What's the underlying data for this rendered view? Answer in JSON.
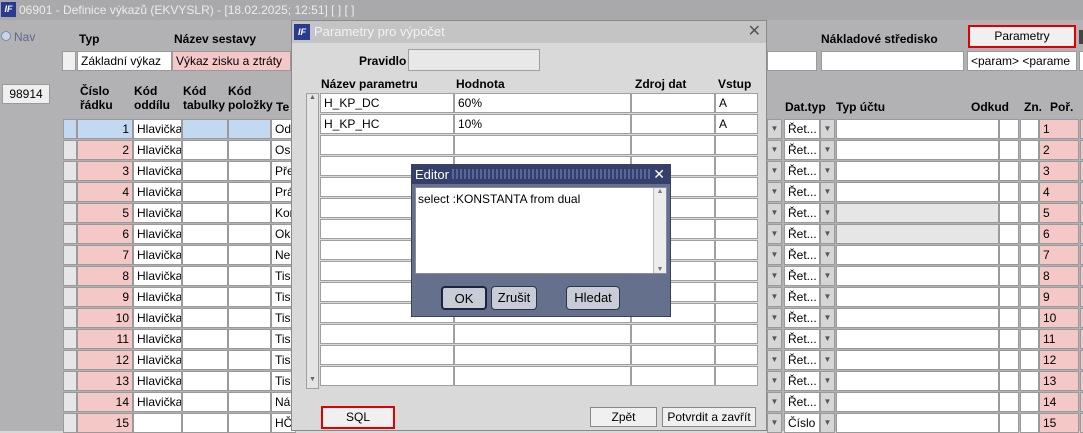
{
  "window": {
    "title": "06901 - Definice výkazů (EKVYSLR) - [18.02.2025; 12:51]  [ ]  [ ]",
    "logo": "IF"
  },
  "nav": {
    "label": "Nav",
    "code": "98914"
  },
  "header": {
    "typ_label": "Typ",
    "nazev_label": "Název sestavy",
    "typ_value": "Základní výkaz",
    "nazev_value": "Výkaz zisku a ztráty",
    "naklad_label": "Nákladové středisko",
    "parametry_button": "Parametry",
    "param_value": "<param>  <parame"
  },
  "grid": {
    "col_cislo": "Číslo řádku",
    "col_cislo_1": "Číslo",
    "col_cislo_2": "řádku",
    "col_oddil_1": "Kód",
    "col_oddil_2": "oddílu",
    "col_tabulka_1": "Kód",
    "col_tabulka_2": "tabulky",
    "col_polozka_1": "Kód",
    "col_polozka_2": "položky",
    "col_t": "Te",
    "col_dattyp": "Dat.typ",
    "col_typucetu": "Typ účtu",
    "col_odkud": "Odkud",
    "col_zn": "Zn.",
    "col_por": "Poř.",
    "rows": [
      {
        "n": "1",
        "oddil": "Hlavička",
        "t": "Odd",
        "dt": "Řet...",
        "por": "1"
      },
      {
        "n": "2",
        "oddil": "Hlavička",
        "t": "Osn",
        "dt": "Řet...",
        "por": "2"
      },
      {
        "n": "3",
        "oddil": "Hlavička",
        "t": "Pře",
        "dt": "Řet...",
        "por": "3"
      },
      {
        "n": "4",
        "oddil": "Hlavička",
        "t": "Prá",
        "dt": "Řet...",
        "por": "4"
      },
      {
        "n": "5",
        "oddil": "Hlavička",
        "t": "Kon",
        "dt": "Řet...",
        "por": "5"
      },
      {
        "n": "6",
        "oddil": "Hlavička",
        "t": "Okr",
        "dt": "Řet...",
        "por": "6"
      },
      {
        "n": "7",
        "oddil": "Hlavička",
        "t": "Ne",
        "dt": "Řet...",
        "por": "7"
      },
      {
        "n": "8",
        "oddil": "Hlavička",
        "t": "Tis",
        "dt": "Řet...",
        "por": "8"
      },
      {
        "n": "9",
        "oddil": "Hlavička",
        "t": "Tis",
        "dt": "Řet...",
        "por": "9"
      },
      {
        "n": "10",
        "oddil": "Hlavička",
        "t": "Tis",
        "dt": "Řet...",
        "por": "10"
      },
      {
        "n": "11",
        "oddil": "Hlavička",
        "t": "Tis",
        "dt": "Řet...",
        "por": "11"
      },
      {
        "n": "12",
        "oddil": "Hlavička",
        "t": "Tis",
        "dt": "Řet...",
        "por": "12"
      },
      {
        "n": "13",
        "oddil": "Hlavička",
        "t": "Tis",
        "dt": "Řet...",
        "por": "13"
      },
      {
        "n": "14",
        "oddil": "Hlavička",
        "t": "Ná",
        "dt": "Řet...",
        "por": "14"
      },
      {
        "n": "15",
        "oddil": "",
        "t": "HČ",
        "dt": "Číslo",
        "por": "15"
      }
    ]
  },
  "dialog": {
    "title": "Parametry pro výpočet",
    "pravidlo_label": "Pravidlo",
    "col_nazev": "Název parametru",
    "col_hodnota": "Hodnota",
    "col_zdroj": "Zdroj dat",
    "col_vstup": "Vstup",
    "params": [
      {
        "nazev": "H_KP_DC",
        "hodnota": "60%",
        "zdroj": "",
        "vstup": "A"
      },
      {
        "nazev": "H_KP_HC",
        "hodnota": "10%",
        "zdroj": "",
        "vstup": "A"
      }
    ],
    "sql_button": "SQL",
    "zpet_button": "Zpět",
    "potvrdit_button": "Potvrdit a zavřít"
  },
  "editor": {
    "title": "Editor",
    "text": "select :KONSTANTA from dual",
    "ok_button": "OK",
    "zrusit_button": "Zrušit",
    "hledat_button": "Hledat"
  }
}
